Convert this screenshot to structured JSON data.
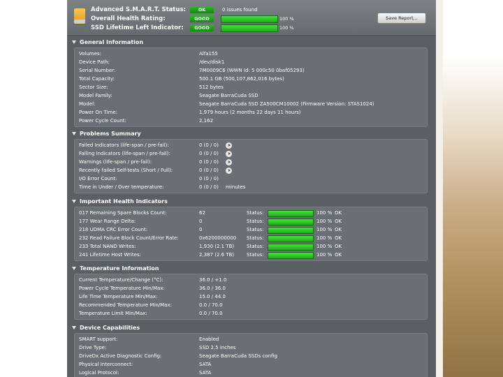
{
  "header": {
    "rows": [
      {
        "label": "Advanced S.M.A.R.T. Status:",
        "badge": "OK",
        "text": "0 issues found"
      },
      {
        "label": "Overall Health Rating:",
        "badge": "GOOD",
        "percent": 1.0,
        "pct_label": "100 %"
      },
      {
        "label": "SSD Lifetime Left Indicator:",
        "badge": "GOOD",
        "percent": 1.0,
        "pct_label": "100 %"
      }
    ],
    "save_label": "Save Report..."
  },
  "general": {
    "title": "General Information",
    "rows": [
      {
        "label": "Volumes:",
        "value": "Alfa155"
      },
      {
        "label": "Device Path:",
        "value": "/dev/disk1"
      },
      {
        "label": "Serial Number:",
        "value": "7M0009C6 (WWN Id: 5 000c50 0baf05293)"
      },
      {
        "label": "Total Capacity:",
        "value": "500.1 GB (500,107,862,016 bytes)"
      },
      {
        "label": "Sector Size:",
        "value": "512 bytes"
      },
      {
        "label": "Model Family:",
        "value": "Seagate BarraCuda SSD"
      },
      {
        "label": "Model:",
        "value": "Seagate BarraCuda SSD ZA500CM10002  (Firmware Version: STAS1024)"
      },
      {
        "label": "Power On Time:",
        "value": "1,979 hours (2 months 22 days 11 hours)"
      },
      {
        "label": "Power Cycle Count:",
        "value": "2,162"
      }
    ]
  },
  "problems": {
    "title": "Problems Summary",
    "rows": [
      {
        "label": "Failed Indicators (life-span / pre-fail):",
        "value": "0 (0 / 0)"
      },
      {
        "label": "Failing Indicators (life-span / pre-fail):",
        "value": "0 (0 / 0)"
      },
      {
        "label": "Warnings (life-span / pre-fail):",
        "value": "0 (0 / 0)"
      },
      {
        "label": "Recently failed Self-tests (Short / Full):",
        "value": "0 (0 / 0)"
      },
      {
        "label": "I/O Error Count:",
        "value": "0 (0 / 0)"
      },
      {
        "label": "Time in Under / Over temperature:",
        "value": "0 (0 / 0)",
        "unit": "minutes"
      }
    ]
  },
  "health": {
    "title": "Important Health Indicators",
    "status_label": "Status:",
    "rows": [
      {
        "label": "017  Remaining Spare Blocks Count:",
        "value": "62",
        "percent": 1.0,
        "pct_label": "100 %",
        "ok": "OK"
      },
      {
        "label": "177  Wear Range Delta:",
        "value": "0",
        "percent": 1.0,
        "pct_label": "100 %",
        "ok": "OK"
      },
      {
        "label": "218  UDMA CRC Error Count:",
        "value": "0",
        "percent": 1.0,
        "pct_label": "100 %",
        "ok": "OK"
      },
      {
        "label": "232  Read Failure Block Count/Error Rate:",
        "value": "0x6200000000",
        "percent": 1.0,
        "pct_label": "100 %",
        "ok": "OK"
      },
      {
        "label": "233  Total NAND Writes:",
        "value": "1,930 (2.1 TB)",
        "percent": 1.0,
        "pct_label": "100 %",
        "ok": "OK"
      },
      {
        "label": "241  Lifetime Host Writes:",
        "value": "2,387 (2.6 TB)",
        "percent": 1.0,
        "pct_label": "100 %",
        "ok": "OK"
      }
    ]
  },
  "temperature": {
    "title": "Temperature Information",
    "rows": [
      {
        "label": "Current Temperature/Change (°C):",
        "value": "36.0 / +1.0"
      },
      {
        "label": "Power Cycle Temperature Min/Max:",
        "value": "36.0 / 36.0"
      },
      {
        "label": "Life Time Temperature Min/Max:",
        "value": "15.0 / 44.0"
      },
      {
        "label": "Recommended Temperature Min/Max:",
        "value": "0.0   / 70.0"
      },
      {
        "label": "Temperature Limit Min/Max:",
        "value": "0.0   / 70.0"
      }
    ]
  },
  "capabilities": {
    "title": "Device Capabilities",
    "rows": [
      {
        "label": "SMART support:",
        "value": "Enabled"
      },
      {
        "label": "Drive Type:",
        "value": "SSD 2.5 inches"
      },
      {
        "label": "DriveDx Active Diagnostic Config:",
        "value": "Seagate BarraCuda SSDs config"
      },
      {
        "label": "Physical Interconnect:",
        "value": "SATA"
      },
      {
        "label": "Logical Protocol:",
        "value": "SATA"
      }
    ]
  }
}
